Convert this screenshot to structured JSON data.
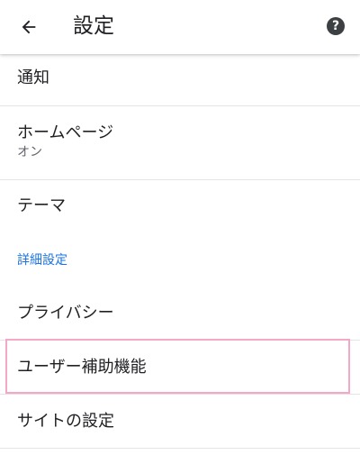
{
  "app_bar": {
    "title": "設定",
    "back_icon": "arrow-left-icon",
    "help_icon": "help-circle-icon",
    "help_glyph": "?"
  },
  "items": {
    "notifications": {
      "label": "通知"
    },
    "homepage": {
      "label": "ホームページ",
      "sublabel": "オン"
    },
    "theme": {
      "label": "テーマ"
    },
    "advanced_header": "詳細設定",
    "privacy": {
      "label": "プライバシー"
    },
    "accessibility": {
      "label": "ユーザー補助機能"
    },
    "site_settings": {
      "label": "サイトの設定"
    }
  },
  "colors": {
    "section_header": "#1a73e8",
    "highlight": "#f4a7c7",
    "text_primary": "#202124",
    "text_secondary": "#5f6368"
  }
}
